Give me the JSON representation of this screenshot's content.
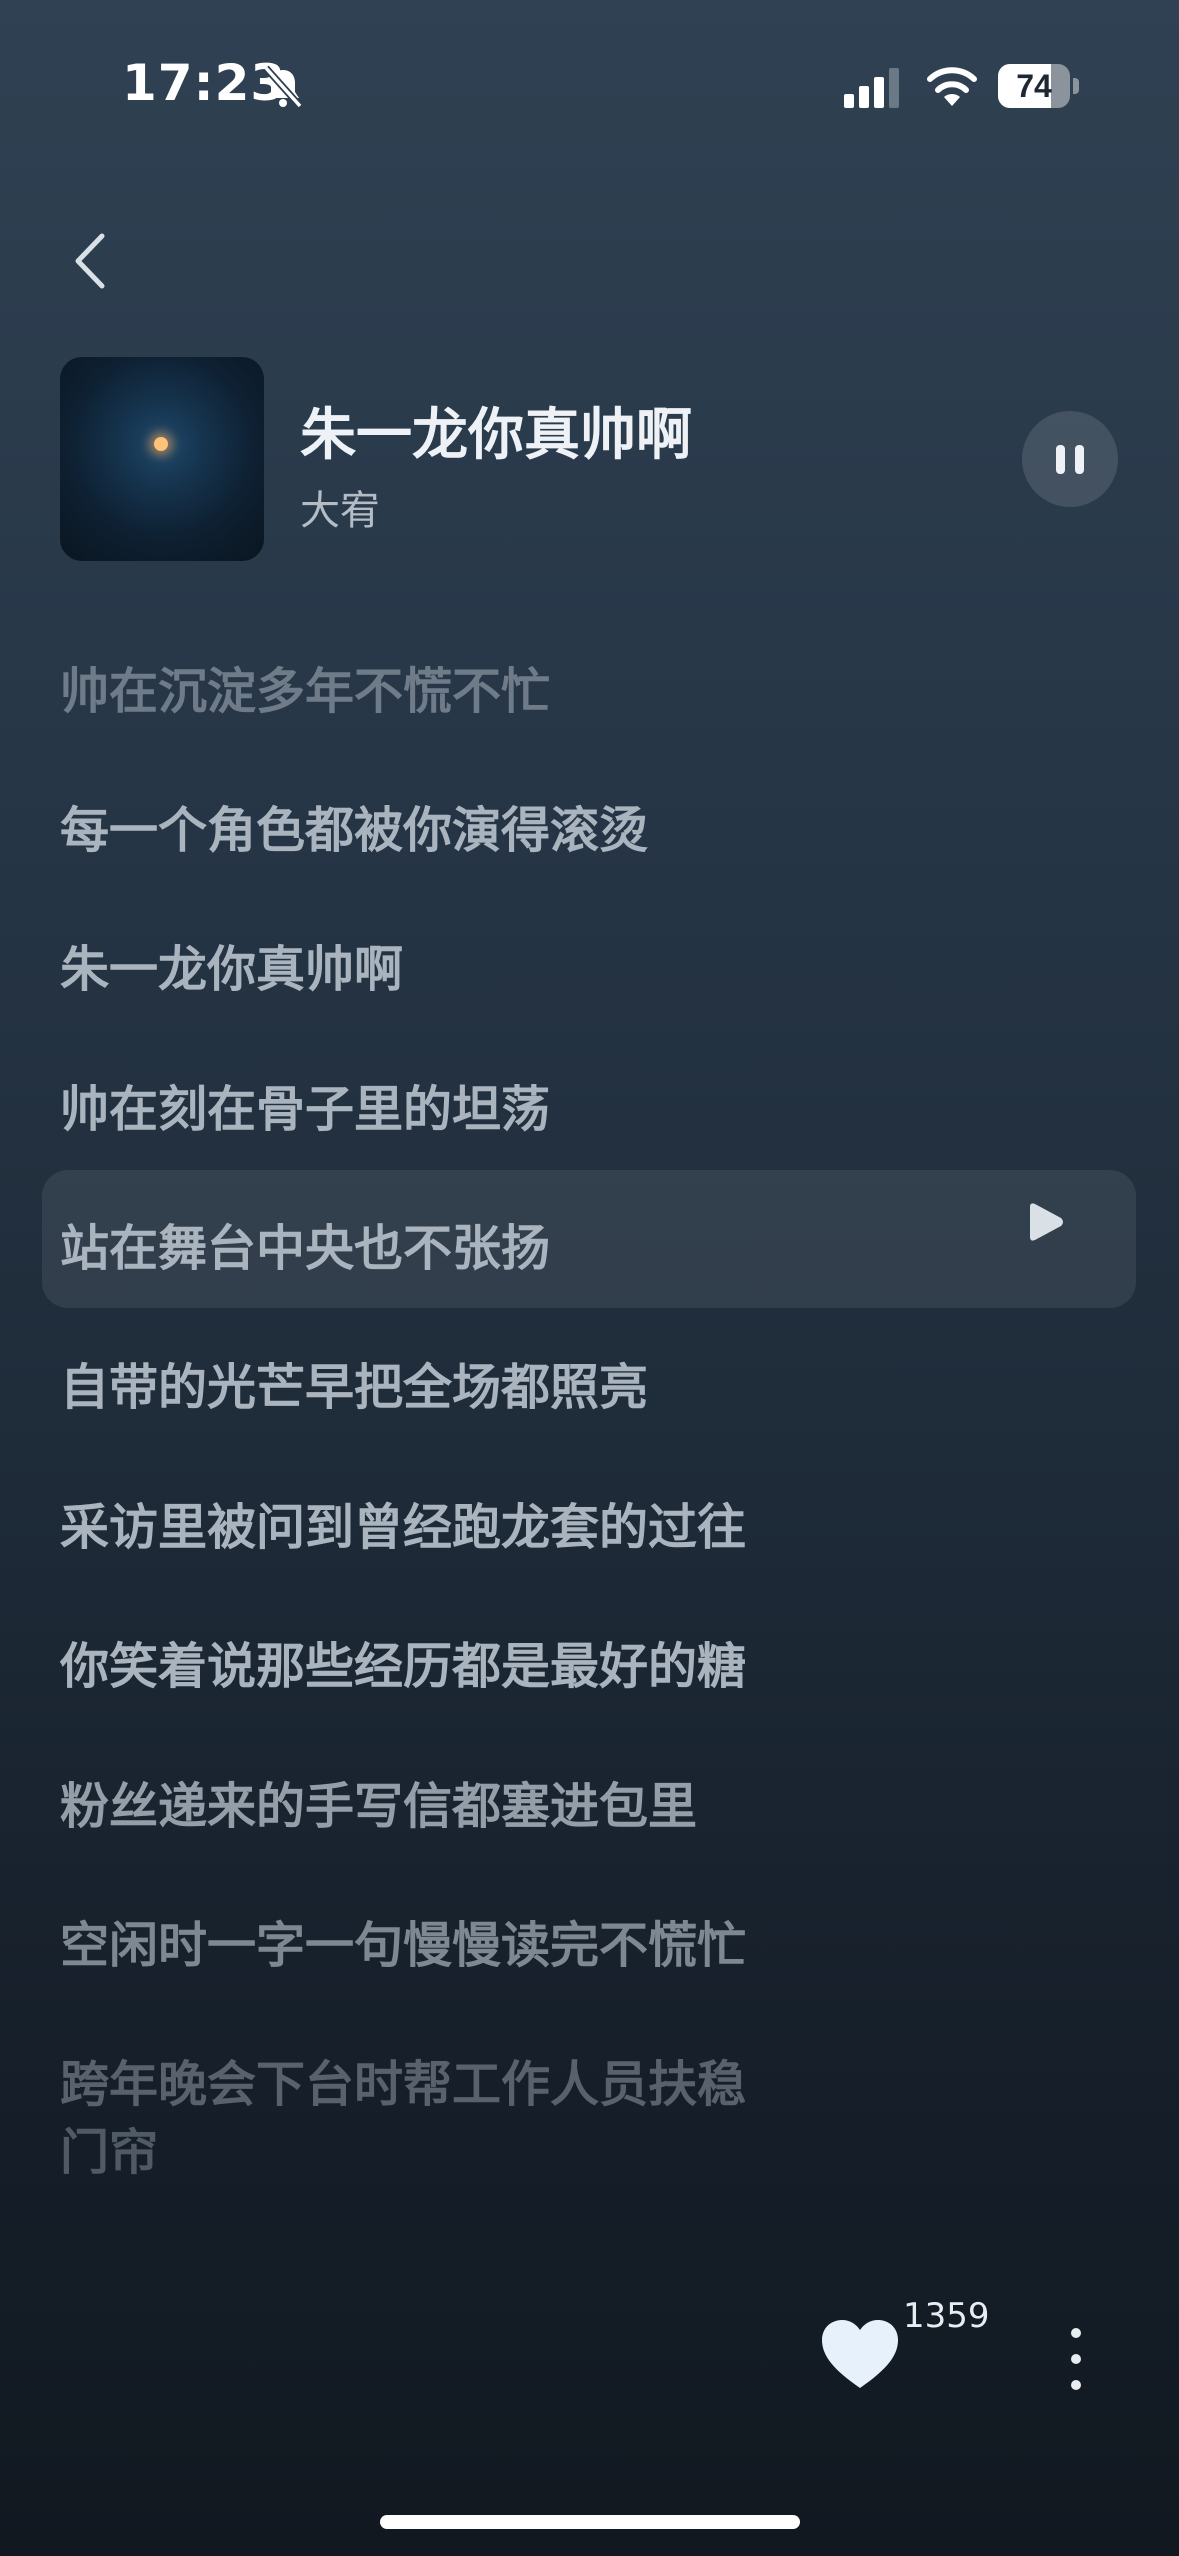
{
  "status_bar": {
    "time": "17:23",
    "battery_percent": 74,
    "battery_label": "74",
    "icons": [
      "bell-slash-icon",
      "cellular-signal-icon",
      "wifi-icon",
      "battery-icon"
    ]
  },
  "nav": {
    "back_icon": "chevron-left-icon"
  },
  "song": {
    "title": "朱一龙你真帅啊",
    "artist": "大宥",
    "playback_icon": "pause-icon"
  },
  "lyrics": [
    "帅在沉淀多年不慌不忙",
    "每一个角色都被你演得滚烫",
    "朱一龙你真帅啊",
    "帅在刻在骨子里的坦荡",
    "站在舞台中央也不张扬",
    "自带的光芒早把全场都照亮",
    "采访里被问到曾经跑龙套的过往",
    "你笑着说那些经历都是最好的糖",
    "粉丝递来的手写信都塞进包里",
    "空闲时一字一句慢慢读完不慌忙",
    "跨年晚会下台时帮工作人员扶稳",
    "门帘"
  ],
  "active_lyric_index": 4,
  "actions": {
    "like_count": "1359",
    "like_icon": "heart-icon",
    "more_icon": "more-vertical-icon"
  },
  "colors": {
    "background_top": "#2f4152",
    "background_bottom": "#111820",
    "lyric_text": "#aab4be",
    "highlight": "#ffffff"
  }
}
